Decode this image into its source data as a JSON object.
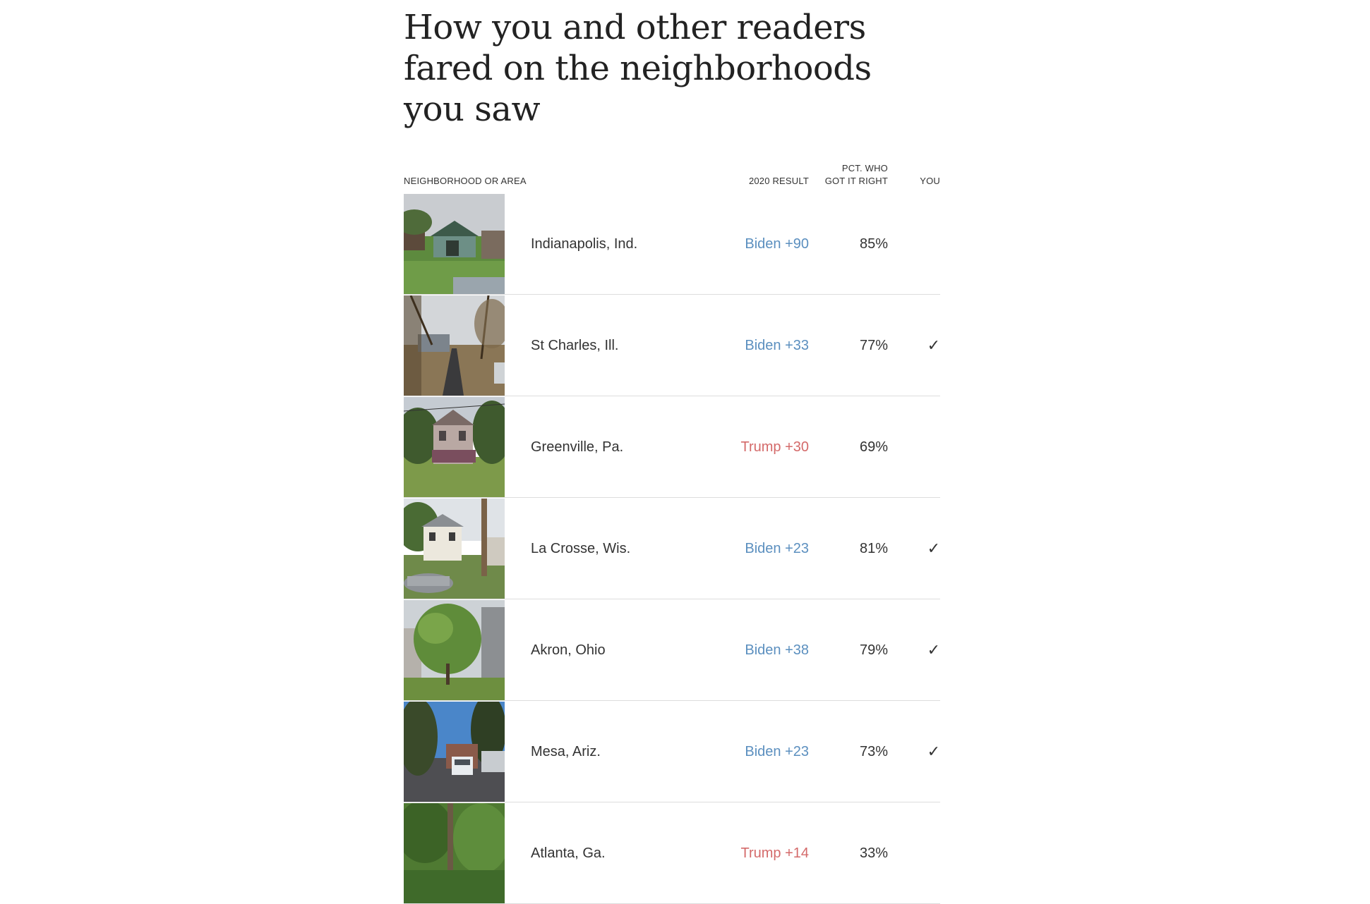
{
  "headline": "How you and other readers fared on the neighborhoods you saw",
  "table": {
    "col_area": "NEIGHBORHOOD OR AREA",
    "col_result": "2020 RESULT",
    "col_pct_line1": "PCT. WHO",
    "col_pct_line2": "GOT IT RIGHT",
    "col_you": "YOU"
  },
  "colors": {
    "biden": "#5b8fbf",
    "trump": "#d46a6a"
  },
  "rows": [
    {
      "place": "Indianapolis, Ind.",
      "result": "Biden +90",
      "party": "biden",
      "pct": "85%",
      "you": ""
    },
    {
      "place": "St Charles, Ill.",
      "result": "Biden +33",
      "party": "biden",
      "pct": "77%",
      "you": "✓"
    },
    {
      "place": "Greenville, Pa.",
      "result": "Trump +30",
      "party": "trump",
      "pct": "69%",
      "you": ""
    },
    {
      "place": "La Crosse, Wis.",
      "result": "Biden +23",
      "party": "biden",
      "pct": "81%",
      "you": "✓"
    },
    {
      "place": "Akron, Ohio",
      "result": "Biden +38",
      "party": "biden",
      "pct": "79%",
      "you": "✓"
    },
    {
      "place": "Mesa, Ariz.",
      "result": "Biden +23",
      "party": "biden",
      "pct": "73%",
      "you": "✓"
    },
    {
      "place": "Atlanta, Ga.",
      "result": "Trump +14",
      "party": "trump",
      "pct": "33%",
      "you": ""
    }
  ]
}
